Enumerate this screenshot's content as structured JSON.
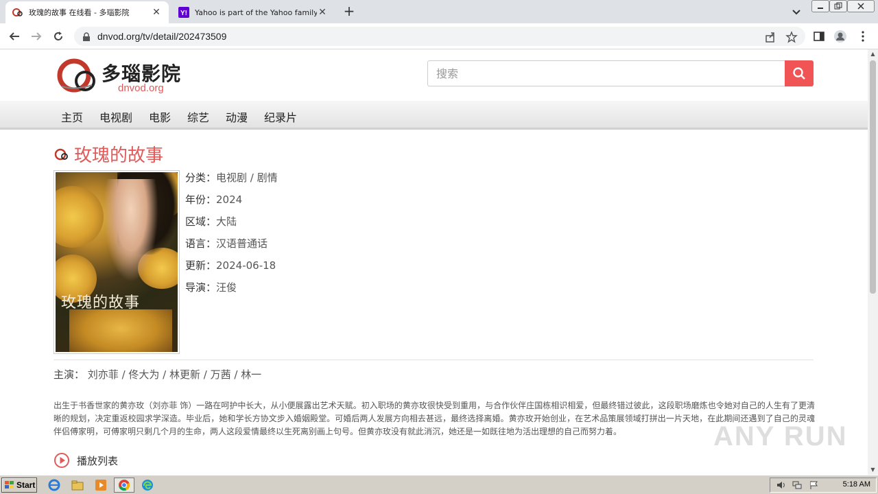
{
  "browser": {
    "tabs": [
      {
        "title": "玫瑰的故事 在线看 - 多瑙影院",
        "active": true
      },
      {
        "title": "Yahoo is part of the Yahoo family of",
        "active": false
      }
    ],
    "url": "dnvod.org/tv/detail/202473509"
  },
  "site": {
    "logo_name": "多瑙影院",
    "logo_domain": "dnvod.org",
    "search_placeholder": "搜索",
    "nav": [
      "主页",
      "电视剧",
      "电影",
      "综艺",
      "动漫",
      "纪录片"
    ]
  },
  "show": {
    "title": "玫瑰的故事",
    "poster_title": "玫瑰的故事",
    "info": [
      {
        "label": "分类：",
        "value": "电视剧 / 剧情"
      },
      {
        "label": "年份：",
        "value": "2024"
      },
      {
        "label": "区域：",
        "value": "大陆"
      },
      {
        "label": "语言：",
        "value": "汉语普通话"
      },
      {
        "label": "更新：",
        "value": "2024-06-18"
      },
      {
        "label": "导演：",
        "value": "汪俊"
      }
    ],
    "cast_label": "主演：",
    "cast": "刘亦菲 / 佟大为 / 林更新 / 万茜 / 林一",
    "description": "出生于书香世家的黄亦玫（刘亦菲 饰）一路在呵护中长大，从小便展露出艺术天赋。初入职场的黄亦玫很快受到重用，与合作伙伴庄国栋相识相爱，但最终错过彼此，这段职场磨炼也令她对自己的人生有了更清晰的规划，决定重返校园求学深造。毕业后，她和学长方协文步入婚姻殿堂。可婚后两人发展方向相去甚远，最终选择离婚。黄亦玫开始创业，在艺术品策展领域打拼出一片天地，在此期间还遇到了自己的灵魂伴侣傅家明，可傅家明只剩几个月的生命，两人这段爱情最终以生死离别画上句号。但黄亦玫没有就此消沉，她还是一如既往地为活出理想的自己而努力着。",
    "playlist_label": "播放列表"
  },
  "watermark": "ANY RUN",
  "taskbar": {
    "start_label": "Start",
    "clock": "5:18 AM"
  }
}
